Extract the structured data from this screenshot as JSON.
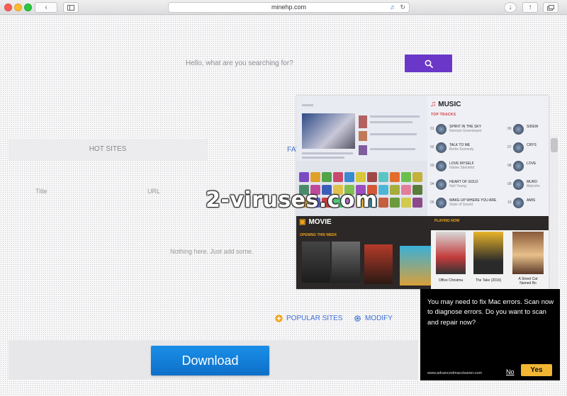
{
  "browser": {
    "url": "minehp.com"
  },
  "search": {
    "placeholder": "Hello, what are you searching for?"
  },
  "tabs": {
    "hot_sites": "HOT SITES",
    "favorites": "FAV"
  },
  "favorites_form": {
    "title_label": "Title",
    "url_label": "URL"
  },
  "empty_message": "Nothing here. Just add some.",
  "links": {
    "popular_sites": "POPULAR SITES",
    "modify": "MODIFY"
  },
  "download": {
    "label": "Download"
  },
  "promo": {
    "music": {
      "title": "MUSIC",
      "section": "TOP TRACKS",
      "tracks": [
        {
          "num": "01",
          "name": "SPIRIT IN THE SKY",
          "artist": "Norman Greenbaum"
        },
        {
          "num": "02",
          "name": "TALK TO ME",
          "artist": "Bertie Kennedy"
        },
        {
          "num": "03",
          "name": "LOVE MYSELF",
          "artist": "Hailee Steinfeld"
        },
        {
          "num": "04",
          "name": "HEART OF GOLD",
          "artist": "Neil Young"
        },
        {
          "num": "05",
          "name": "WAKE UP WHERE YOU ARE",
          "artist": "State of Sound"
        },
        {
          "num": "06",
          "name": "SIDEW",
          "artist": ""
        },
        {
          "num": "07",
          "name": "CRYS",
          "artist": ""
        },
        {
          "num": "08",
          "name": "LOVE",
          "artist": ""
        },
        {
          "num": "09",
          "name": "MURD",
          "artist": "Malcolm"
        },
        {
          "num": "10",
          "name": "AMIS",
          "artist": ""
        }
      ]
    },
    "movie": {
      "title": "MOVIE",
      "opening": "OPENING THIS WEEK",
      "playing": "PLAYING NOW",
      "now_playing": [
        {
          "title": "Office Christma"
        },
        {
          "title": "The Take (2016)"
        },
        {
          "title": "A Street Cat Named Bo"
        }
      ]
    },
    "watermark": "2-viruses.com"
  },
  "popup": {
    "message": "You may need to fix Mac errors. Scan now to diagnose errors. Do you want to scan and repair now?",
    "site": "www.advancedmaccleaner.com",
    "no_label": "No",
    "yes_label": "Yes"
  },
  "colors": {
    "search_button": "#6a37c9",
    "download_button": "#1a8fe8",
    "link_blue": "#3d6fd6",
    "popup_yes": "#f2b632",
    "popular_icon": "#f0a318"
  }
}
